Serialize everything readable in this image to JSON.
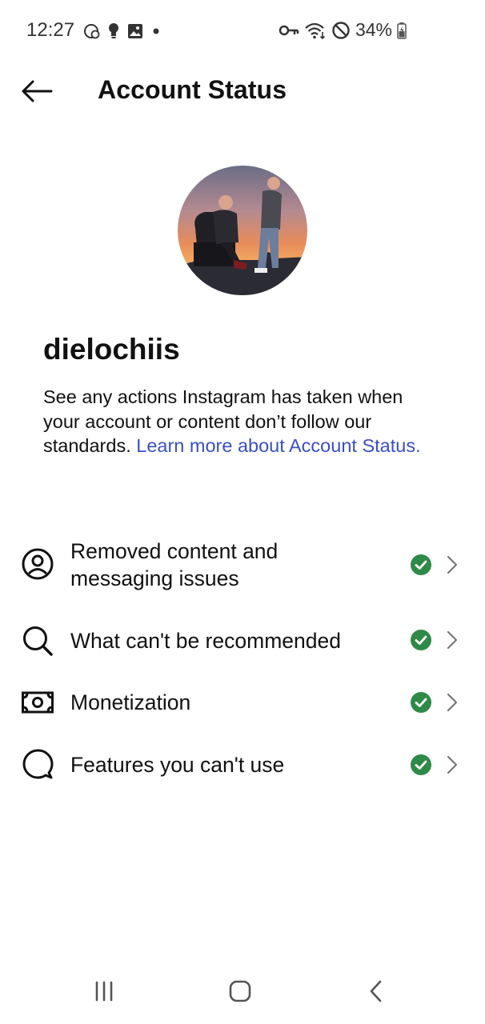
{
  "status_bar": {
    "time": "12:27",
    "battery_percent": "34%",
    "icons": [
      "sync-icon",
      "lightbulb-icon",
      "image-icon",
      "dot-icon",
      "vpn-key-icon",
      "wifi-icon",
      "do-not-disturb-icon",
      "battery-icon"
    ]
  },
  "header": {
    "title": "Account Status",
    "back_icon": "back-arrow-icon"
  },
  "profile": {
    "username": "dielochiis",
    "description_text": "See any actions Instagram has taken when your account or content don’t follow our standards. ",
    "learn_more_text": "Learn more about Account Status."
  },
  "items": [
    {
      "label_line1": "Removed content and",
      "label_line2": "messaging issues",
      "icon": "person-circle-icon",
      "status": "ok"
    },
    {
      "label": "What can't be recommended",
      "icon": "search-icon",
      "status": "ok"
    },
    {
      "label": "Monetization",
      "icon": "money-icon",
      "status": "ok"
    },
    {
      "label": "Features you can't use",
      "icon": "speech-bubble-icon",
      "status": "ok"
    }
  ],
  "colors": {
    "accent_link": "#3a4fc4",
    "check_green": "#2e8a47"
  },
  "nav_bar": {
    "buttons": [
      "recent-apps-icon",
      "home-icon",
      "back-icon"
    ]
  }
}
